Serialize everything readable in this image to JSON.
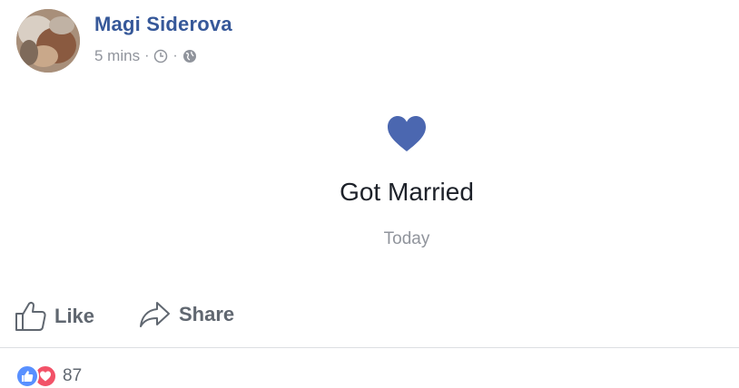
{
  "post": {
    "author_name": "Magi Siderova",
    "timestamp": "5 mins",
    "separator": "·",
    "icons": [
      "clock-icon",
      "globe-icon"
    ]
  },
  "life_event": {
    "icon": "heart-icon",
    "icon_color": "#4b67b0",
    "title": "Got Married",
    "date": "Today"
  },
  "actions": {
    "like_label": "Like",
    "share_label": "Share"
  },
  "reactions": {
    "types": [
      "like-icon",
      "love-icon"
    ],
    "count": "87"
  }
}
